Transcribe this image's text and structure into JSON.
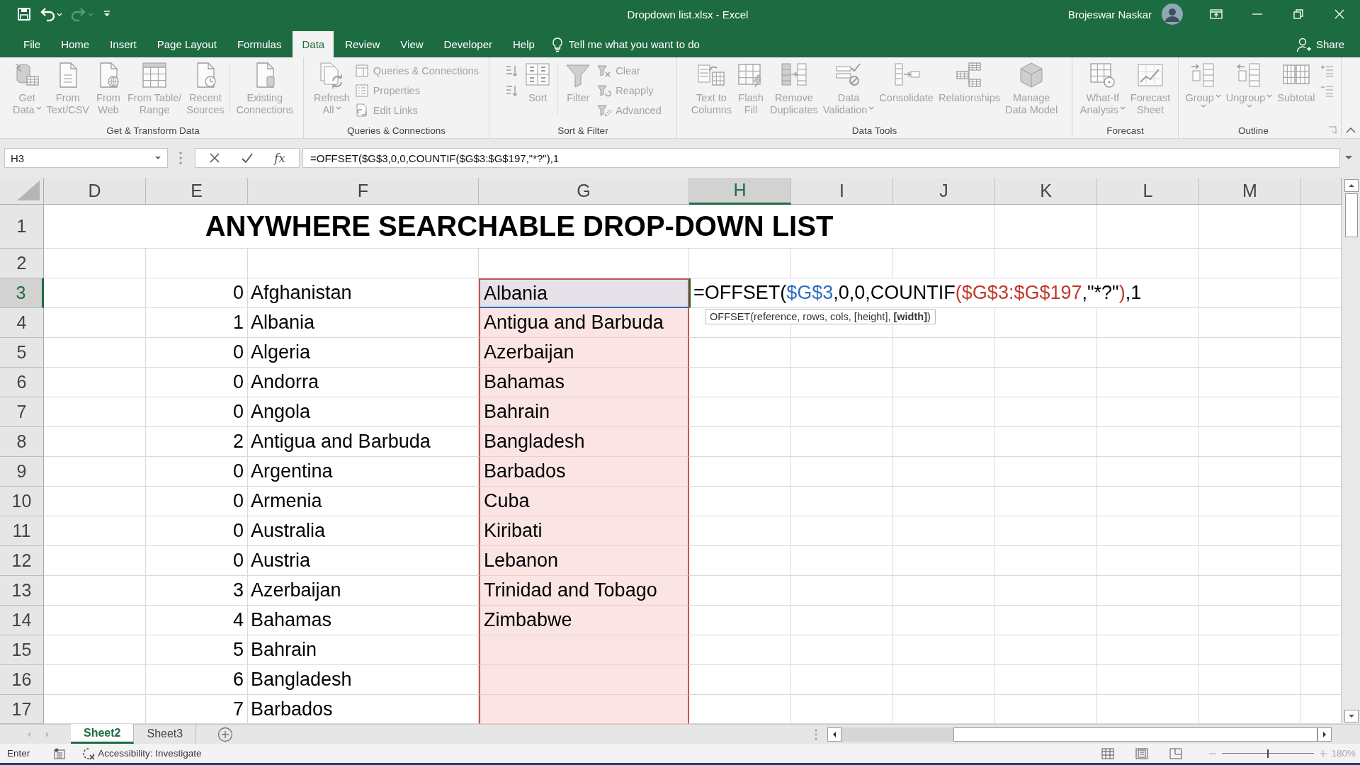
{
  "title_bar": {
    "quick_access": [
      {
        "kind": "save",
        "disabled": false
      },
      {
        "kind": "undo",
        "disabled": false
      },
      {
        "kind": "redo",
        "disabled": true
      },
      {
        "kind": "customize",
        "disabled": false
      }
    ],
    "title": "Dropdown list.xlsx - Excel",
    "user": "Brojeswar Naskar"
  },
  "tabs": [
    {
      "label": "File",
      "selected": false
    },
    {
      "label": "Home",
      "selected": false
    },
    {
      "label": "Insert",
      "selected": false
    },
    {
      "label": "Page Layout",
      "selected": false
    },
    {
      "label": "Formulas",
      "selected": false
    },
    {
      "label": "Data",
      "selected": true
    },
    {
      "label": "Review",
      "selected": false
    },
    {
      "label": "View",
      "selected": false
    },
    {
      "label": "Developer",
      "selected": false
    },
    {
      "label": "Help",
      "selected": false
    }
  ],
  "tell_me": {
    "placeholder": "Tell me what you want to do"
  },
  "share": "Share",
  "ribbon": {
    "disabled": true,
    "groups": [
      {
        "label": "Get & Transform Data",
        "launcher": false,
        "buttons": [
          {
            "kind": "large",
            "lines": [
              "Get",
              "Data"
            ],
            "dropdown": true
          },
          {
            "kind": "large",
            "lines": [
              "From",
              "Text/CSV"
            ],
            "dropdown": false
          },
          {
            "kind": "large",
            "lines": [
              "From",
              "Web"
            ],
            "dropdown": false
          },
          {
            "kind": "large",
            "lines": [
              "From Table/",
              "Range"
            ],
            "dropdown": false
          },
          {
            "kind": "large",
            "lines": [
              "Recent",
              "Sources"
            ],
            "dropdown": false
          },
          {
            "kind": "separator"
          },
          {
            "kind": "large",
            "lines": [
              "Existing",
              "Connections"
            ],
            "dropdown": false
          }
        ]
      },
      {
        "label": "Queries & Connections",
        "launcher": false,
        "buttons": [
          {
            "kind": "large",
            "lines": [
              "Refresh",
              "All"
            ],
            "dropdown": true
          },
          {
            "kind": "stack",
            "items": [
              {
                "kind": "labeled",
                "label": "Queries & Connections"
              },
              {
                "kind": "labeled",
                "label": "Properties"
              },
              {
                "kind": "labeled",
                "label": "Edit Links"
              }
            ]
          }
        ]
      },
      {
        "label": "Sort & Filter",
        "launcher": false,
        "buttons": [
          {
            "kind": "stack",
            "items": [
              {
                "kind": "icon"
              },
              {
                "kind": "icon"
              }
            ]
          },
          {
            "kind": "large",
            "lines": [
              "Sort"
            ],
            "dropdown": false
          },
          {
            "kind": "separator"
          },
          {
            "kind": "large",
            "lines": [
              "Filter"
            ],
            "dropdown": false
          },
          {
            "kind": "stack",
            "items": [
              {
                "kind": "labeled",
                "label": "Clear"
              },
              {
                "kind": "labeled",
                "label": "Reapply"
              },
              {
                "kind": "labeled",
                "label": "Advanced"
              }
            ]
          }
        ]
      },
      {
        "label": "Data Tools",
        "launcher": false,
        "buttons": [
          {
            "kind": "large",
            "lines": [
              "Text to",
              "Columns"
            ],
            "dropdown": false
          },
          {
            "kind": "large",
            "lines": [
              "Flash",
              "Fill"
            ],
            "dropdown": false
          },
          {
            "kind": "large",
            "lines": [
              "Remove",
              "Duplicates"
            ],
            "dropdown": false
          },
          {
            "kind": "large",
            "lines": [
              "Data",
              "Validation"
            ],
            "dropdown": true
          },
          {
            "kind": "large",
            "lines": [
              "Consolidate"
            ],
            "dropdown": false
          },
          {
            "kind": "large",
            "lines": [
              "Relationships"
            ],
            "dropdown": false
          },
          {
            "kind": "large",
            "lines": [
              "Manage",
              "Data Model"
            ],
            "dropdown": false
          }
        ]
      },
      {
        "label": "Forecast",
        "launcher": false,
        "buttons": [
          {
            "kind": "large",
            "lines": [
              "What-If",
              "Analysis"
            ],
            "dropdown": true
          },
          {
            "kind": "large",
            "lines": [
              "Forecast",
              "Sheet"
            ],
            "dropdown": false
          }
        ]
      },
      {
        "label": "Outline",
        "launcher": true,
        "buttons": [
          {
            "kind": "large",
            "lines": [
              "Group"
            ],
            "dropdown": true
          },
          {
            "kind": "large",
            "lines": [
              "Ungroup"
            ],
            "dropdown": true
          },
          {
            "kind": "large",
            "lines": [
              "Subtotal"
            ],
            "dropdown": false
          },
          {
            "kind": "stack",
            "items": [
              {
                "kind": "icon"
              },
              {
                "kind": "icon"
              }
            ]
          }
        ]
      }
    ]
  },
  "formula_bar": {
    "name_box": "H3",
    "function_button": "fx",
    "formula": "=OFFSET($G$3,0,0,COUNTIF($G$3:$G$197,\"*?\"),1"
  },
  "sheet": {
    "columns": [
      {
        "label": "D",
        "selected": false
      },
      {
        "label": "E",
        "selected": false
      },
      {
        "label": "F",
        "selected": false
      },
      {
        "label": "G",
        "selected": false
      },
      {
        "label": "H",
        "selected": true
      },
      {
        "label": "I",
        "selected": false
      },
      {
        "label": "J",
        "selected": false
      },
      {
        "label": "K",
        "selected": false
      },
      {
        "label": "L",
        "selected": false
      },
      {
        "label": "M",
        "selected": false
      }
    ],
    "rows": [
      {
        "label": "1",
        "selected": false,
        "title": "ANYWHERE SEARCHABLE DROP-DOWN LIST"
      },
      {
        "label": "2",
        "selected": false
      },
      {
        "label": "3",
        "selected": true,
        "count": "0",
        "country": "Afghanistan",
        "result": {
          "text": "Albania",
          "highlighted": true,
          "referenced": true
        },
        "editor": {
          "parts": [
            {
              "text": "=OFFSET(",
              "color": "#000000"
            },
            {
              "text": "$G$3",
              "color": "#2e6fc0"
            },
            {
              "text": ",0,0,COUNTIF",
              "color": "#000000"
            },
            {
              "text": "($G$3:$G$197",
              "color": "#c0392b"
            },
            {
              "text": ",\"*?\"",
              "color": "#000000"
            },
            {
              "text": ")",
              "color": "#c0392b"
            },
            {
              "text": ",1",
              "color": "#000000"
            }
          ],
          "tooltip": "OFFSET(reference, rows, cols, [height], **[width]**)"
        }
      },
      {
        "label": "4",
        "selected": false,
        "count": "1",
        "country": "Albania",
        "result": {
          "text": "Antigua and Barbuda",
          "highlighted": true,
          "referenced": false
        }
      },
      {
        "label": "5",
        "selected": false,
        "count": "0",
        "country": "Algeria",
        "result": {
          "text": "Azerbaijan",
          "highlighted": true,
          "referenced": false
        }
      },
      {
        "label": "6",
        "selected": false,
        "count": "0",
        "country": "Andorra",
        "result": {
          "text": "Bahamas",
          "highlighted": true,
          "referenced": false
        }
      },
      {
        "label": "7",
        "selected": false,
        "count": "0",
        "country": "Angola",
        "result": {
          "text": "Bahrain",
          "highlighted": true,
          "referenced": false
        }
      },
      {
        "label": "8",
        "selected": false,
        "count": "2",
        "country": "Antigua and Barbuda",
        "result": {
          "text": "Bangladesh",
          "highlighted": true,
          "referenced": false
        }
      },
      {
        "label": "9",
        "selected": false,
        "count": "0",
        "country": "Argentina",
        "result": {
          "text": "Barbados",
          "highlighted": true,
          "referenced": false
        }
      },
      {
        "label": "10",
        "selected": false,
        "count": "0",
        "country": "Armenia",
        "result": {
          "text": "Cuba",
          "highlighted": true,
          "referenced": false
        }
      },
      {
        "label": "11",
        "selected": false,
        "count": "0",
        "country": "Australia",
        "result": {
          "text": "Kiribati",
          "highlighted": true,
          "referenced": false
        }
      },
      {
        "label": "12",
        "selected": false,
        "count": "0",
        "country": "Austria",
        "result": {
          "text": "Lebanon",
          "highlighted": true,
          "referenced": false
        }
      },
      {
        "label": "13",
        "selected": false,
        "count": "3",
        "country": "Azerbaijan",
        "result": {
          "text": "Trinidad and Tobago",
          "highlighted": true,
          "referenced": false
        }
      },
      {
        "label": "14",
        "selected": false,
        "count": "4",
        "country": "Bahamas",
        "result": {
          "text": "Zimbabwe",
          "highlighted": true,
          "referenced": false
        }
      },
      {
        "label": "15",
        "selected": false,
        "count": "5",
        "country": "Bahrain",
        "result": {
          "highlighted": true,
          "referenced": false
        }
      },
      {
        "label": "16",
        "selected": false,
        "count": "6",
        "country": "Bangladesh",
        "result": {
          "highlighted": true,
          "referenced": false
        }
      },
      {
        "label": "17",
        "selected": false,
        "count": "7",
        "country": "Barbados",
        "result": {
          "highlighted": true,
          "referenced": false
        }
      }
    ]
  },
  "sheet_tabs": [
    {
      "label": "Sheet2",
      "selected": true
    },
    {
      "label": "Sheet3",
      "selected": false
    }
  ],
  "status_bar": {
    "mode": "Enter",
    "accessibility": "Accessibility: Investigate",
    "zoom": {
      "level": 0.5,
      "label": "180%"
    }
  }
}
